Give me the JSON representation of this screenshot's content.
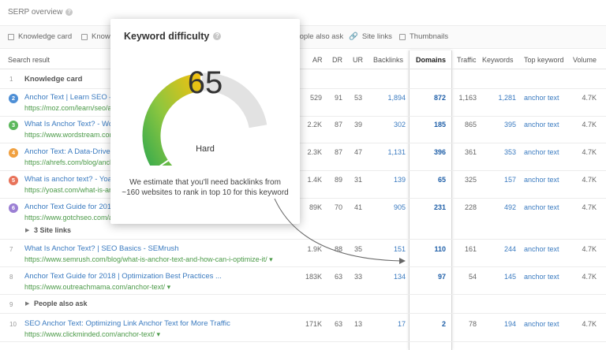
{
  "header": {
    "title": "SERP overview"
  },
  "filters": [
    {
      "label": "Knowledge card",
      "icon": "card-icon"
    },
    {
      "label": "Knowledge",
      "icon": "card-icon"
    },
    {
      "label": "People also ask",
      "icon": "question-icon"
    },
    {
      "label": "Site links",
      "icon": "link-icon"
    },
    {
      "label": "Thumbnails",
      "icon": "image-icon"
    }
  ],
  "columns": {
    "search_result": "Search result",
    "ar": "AR",
    "dr": "DR",
    "ur": "UR",
    "backlinks": "Backlinks",
    "domains": "Domains",
    "traffic": "Traffic",
    "keywords": "Keywords",
    "top_keyword": "Top keyword",
    "volume": "Volume"
  },
  "rows": [
    {
      "num": "1",
      "label": "Knowledge card"
    },
    {
      "num": "2",
      "badge_color": "#4e8fd6",
      "title": "Anchor Text | Learn SEO – Moz",
      "url": "https://moz.com/learn/seo/anchor-text",
      "ar": "529",
      "dr": "91",
      "ur": "53",
      "backlinks": "1,894",
      "domains": "872",
      "traffic": "1,163",
      "keywords": "1,281",
      "top_keyword": "anchor text",
      "volume": "4.7K"
    },
    {
      "num": "3",
      "badge_color": "#5cb85c",
      "title": "What Is Anchor Text? - Wordstream",
      "url": "https://www.wordstream.com/anchor-text",
      "ar": "2.2K",
      "dr": "87",
      "ur": "39",
      "backlinks": "302",
      "domains": "185",
      "traffic": "865",
      "keywords": "395",
      "top_keyword": "anchor text",
      "volume": "4.7K"
    },
    {
      "num": "4",
      "badge_color": "#f0a040",
      "title": "Anchor Text: A Data-Driven Guide",
      "url": "https://ahrefs.com/blog/anchor-text/",
      "ar": "2.3K",
      "dr": "87",
      "ur": "47",
      "backlinks": "1,131",
      "domains": "396",
      "traffic": "361",
      "keywords": "353",
      "top_keyword": "anchor text",
      "volume": "4.7K"
    },
    {
      "num": "5",
      "badge_color": "#e8735a",
      "title": "What is anchor text? - Yoast",
      "url": "https://yoast.com/what-is-anchor-text/",
      "ar": "1.4K",
      "dr": "89",
      "ur": "31",
      "backlinks": "139",
      "domains": "65",
      "traffic": "325",
      "keywords": "157",
      "top_keyword": "anchor text",
      "volume": "4.7K"
    },
    {
      "num": "6",
      "badge_color": "#9b7fd4",
      "title": "Anchor Text Guide for 2018",
      "url": "https://www.gotchseo.com/anchor-text/",
      "ar": "89K",
      "dr": "70",
      "ur": "41",
      "backlinks": "905",
      "domains": "231",
      "traffic": "228",
      "keywords": "492",
      "top_keyword": "anchor text",
      "volume": "4.7K"
    },
    {
      "label": "3 Site links",
      "toggle": "▶"
    },
    {
      "num": "7",
      "title": "What Is Anchor Text? | SEO Basics - SEMrush",
      "url": "https://www.semrush.com/blog/what-is-anchor-text-and-how-can-i-optimize-it/ ▾",
      "ar": "1.9K",
      "dr": "88",
      "ur": "35",
      "backlinks": "151",
      "domains": "110",
      "traffic": "161",
      "keywords": "244",
      "top_keyword": "anchor text",
      "volume": "4.7K"
    },
    {
      "num": "8",
      "title": "Anchor Text Guide for 2018 | Optimization Best Practices ...",
      "url": "https://www.outreachmama.com/anchor-text/ ▾",
      "ar": "183K",
      "dr": "63",
      "ur": "33",
      "backlinks": "134",
      "domains": "97",
      "traffic": "54",
      "keywords": "145",
      "top_keyword": "anchor text",
      "volume": "4.7K"
    },
    {
      "num": "9",
      "label": "People also ask",
      "toggle": "▶"
    },
    {
      "num": "10",
      "title": "SEO Anchor Text: Optimizing Link Anchor Text for More Traffic",
      "url": "https://www.clickminded.com/anchor-text/ ▾",
      "ar": "171K",
      "dr": "63",
      "ur": "13",
      "backlinks": "17",
      "domains": "2",
      "traffic": "78",
      "keywords": "194",
      "top_keyword": "anchor text",
      "volume": "4.7K"
    }
  ],
  "popup": {
    "title": "Keyword difficulty",
    "score": "65",
    "score_fraction": 0.65,
    "level": "Hard",
    "estimate": "We estimate that you'll need backlinks from ~160 websites to rank in top 10 for this keyword",
    "colors": {
      "low": "#2fa84f",
      "mid": "#8cc63f",
      "high": "#f2c10f",
      "empty": "#e2e2e2"
    }
  }
}
